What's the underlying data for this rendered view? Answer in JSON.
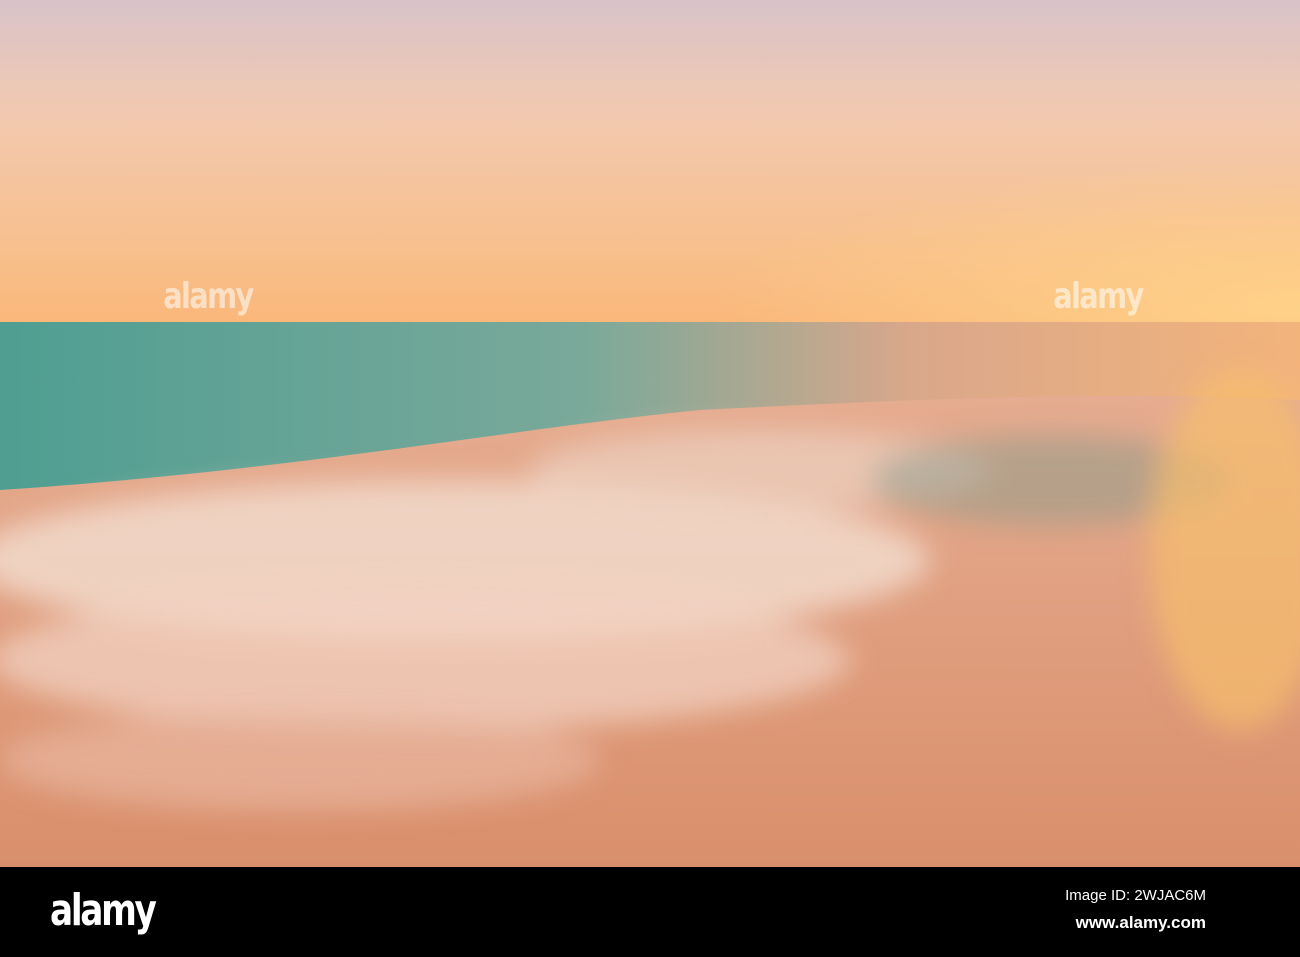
{
  "watermark": {
    "text": "alamy"
  },
  "footer": {
    "logo": "alamy",
    "image_id": "Image ID: 2WJAC6M",
    "site": "www.alamy.com"
  }
}
